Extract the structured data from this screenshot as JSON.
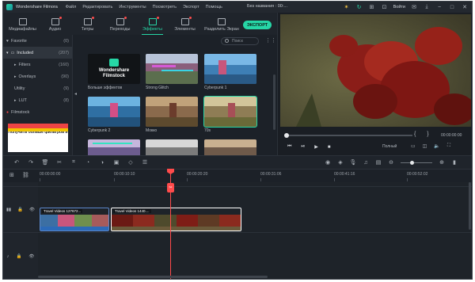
{
  "window": {
    "app_name": "Wondershare Filmora",
    "project_title": "Без названия : 00:...",
    "menu": [
      "Файл",
      "Редактировать",
      "Инструменты",
      "Посмотреть",
      "Экспорт",
      "Помощь"
    ],
    "login_label": "Войти"
  },
  "toolbar": {
    "tabs": [
      {
        "label": "Медиафайлы",
        "icon": "folder-icon"
      },
      {
        "label": "Аудио",
        "icon": "music-note-icon"
      },
      {
        "label": "Титры",
        "icon": "text-icon"
      },
      {
        "label": "Переходы",
        "icon": "transition-icon"
      },
      {
        "label": "Эффекты",
        "icon": "effects-icon"
      },
      {
        "label": "Элементы",
        "icon": "elements-icon"
      },
      {
        "label": "Разделить Экран",
        "icon": "split-screen-icon"
      }
    ],
    "active_tab": "Эффекты",
    "export_label": "ЭКСПОРТ"
  },
  "sidebar": {
    "items": [
      {
        "label": "Favorite",
        "count": "(0)"
      },
      {
        "label": "Included",
        "count": "(207)"
      },
      {
        "label": "Filters",
        "count": "(160)"
      },
      {
        "label": "Overlays",
        "count": "(90)"
      },
      {
        "label": "Utility",
        "count": "(9)"
      },
      {
        "label": "LUT",
        "count": "(8)"
      },
      {
        "label": "Filmstock",
        "count": ""
      }
    ],
    "ad_text": "Получить больше фильтров и"
  },
  "media": {
    "search_placeholder": "Поиск",
    "items": [
      {
        "label": "Больше эффектов",
        "special": "Wondershare Filmstock"
      },
      {
        "label": "Strong Glitch"
      },
      {
        "label": "Cyberpunk 1"
      },
      {
        "label": "Cyberpunk 2"
      },
      {
        "label": "Мокко"
      },
      {
        "label": "70s"
      },
      {
        "label": ""
      },
      {
        "label": ""
      },
      {
        "label": ""
      }
    ]
  },
  "preview": {
    "time": "00:00:00:00",
    "quality": "Полный",
    "progress": 0.0
  },
  "timeline": {
    "ruler": [
      "00:00:00:00",
      "00:00:10:10",
      "00:00:20:20",
      "00:00:31:06",
      "00:00:41:16",
      "00:00:52:02"
    ],
    "clips": [
      {
        "title": "Travel Videos 127672..."
      },
      {
        "title": "Travel Videos 1440...."
      }
    ]
  },
  "colors": {
    "accent": "#26d6a6",
    "playhead": "#ff4b4b",
    "clip_border": "#5b86c9"
  }
}
